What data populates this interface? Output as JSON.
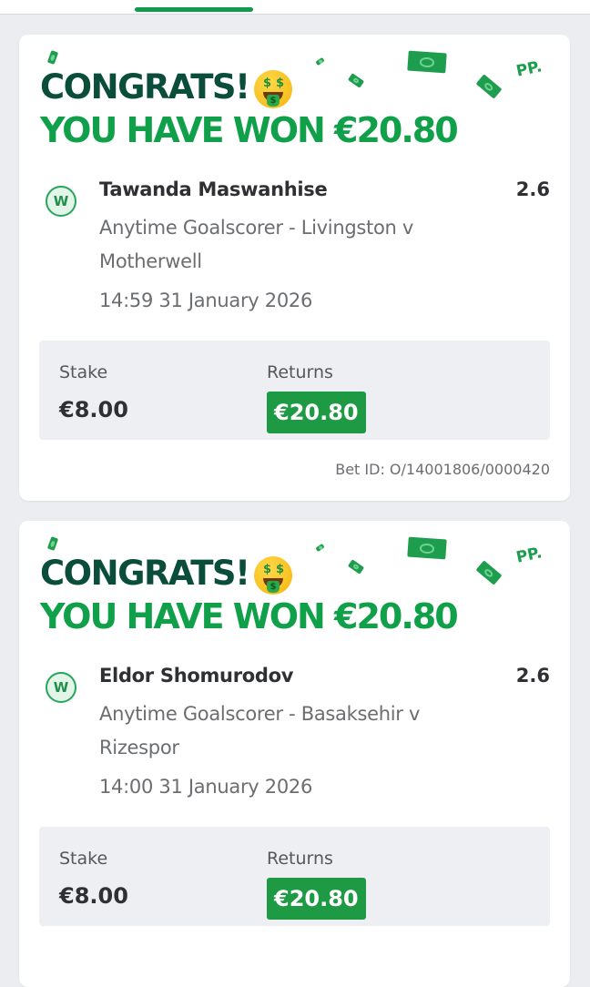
{
  "colors": {
    "accent_green": "#119a4c",
    "dark_green": "#0b4d3b",
    "returns_bg": "#1e9a44",
    "page_bg": "#ebedf0"
  },
  "cards": [
    {
      "headline": "CONGRATS!",
      "emoji_icon": "money-mouth-face-icon",
      "won_text": "YOU HAVE WON €20.80",
      "pp_text": "PP.",
      "result_badge": "W",
      "selection": "Tawanda Maswanhise",
      "odds": "2.6",
      "market": "Anytime Goalscorer - Livingston v Motherwell",
      "datetime": "14:59 31 January 2026",
      "stake_label": "Stake",
      "stake_value": "€8.00",
      "returns_label": "Returns",
      "returns_value": "€20.80",
      "bet_id": "Bet ID: O/14001806/0000420"
    },
    {
      "headline": "CONGRATS!",
      "emoji_icon": "money-mouth-face-icon",
      "won_text": "YOU HAVE WON €20.80",
      "pp_text": "PP.",
      "result_badge": "W",
      "selection": "Eldor Shomurodov",
      "odds": "2.6",
      "market": "Anytime Goalscorer - Basaksehir v Rizespor",
      "datetime": "14:00 31 January 2026",
      "stake_label": "Stake",
      "stake_value": "€8.00",
      "returns_label": "Returns",
      "returns_value": "€20.80"
    }
  ]
}
